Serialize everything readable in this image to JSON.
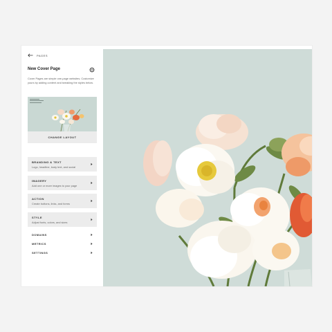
{
  "panel": {
    "back_label": "PAGES",
    "title": "New Cover Page",
    "description": "Cover Pages are simple one-page websites. Customize yours by adding content and tweaking the styles below.",
    "change_layout": "CHANGE LAYOUT"
  },
  "cards": [
    {
      "title": "BRANDING & TEXT",
      "subtitle": "Logo, headline, body text, and social"
    },
    {
      "title": "IMAGERY",
      "subtitle": "Add one or more images to your page"
    },
    {
      "title": "ACTION",
      "subtitle": "Create buttons, links, and forms"
    },
    {
      "title": "STYLE",
      "subtitle": "Adjust fonts, colors, and sizes"
    }
  ],
  "nav": [
    {
      "label": "DOMAINS"
    },
    {
      "label": "METRICS"
    },
    {
      "label": "SETTINGS"
    }
  ],
  "icons": {
    "back": "arrow-left-icon",
    "settings": "gear-icon",
    "chevron": "chevron-right-icon"
  },
  "colors": {
    "page_bg": "#f3f3f3",
    "card_bg": "#ececec",
    "preview_bg": "#cfdcd8"
  }
}
